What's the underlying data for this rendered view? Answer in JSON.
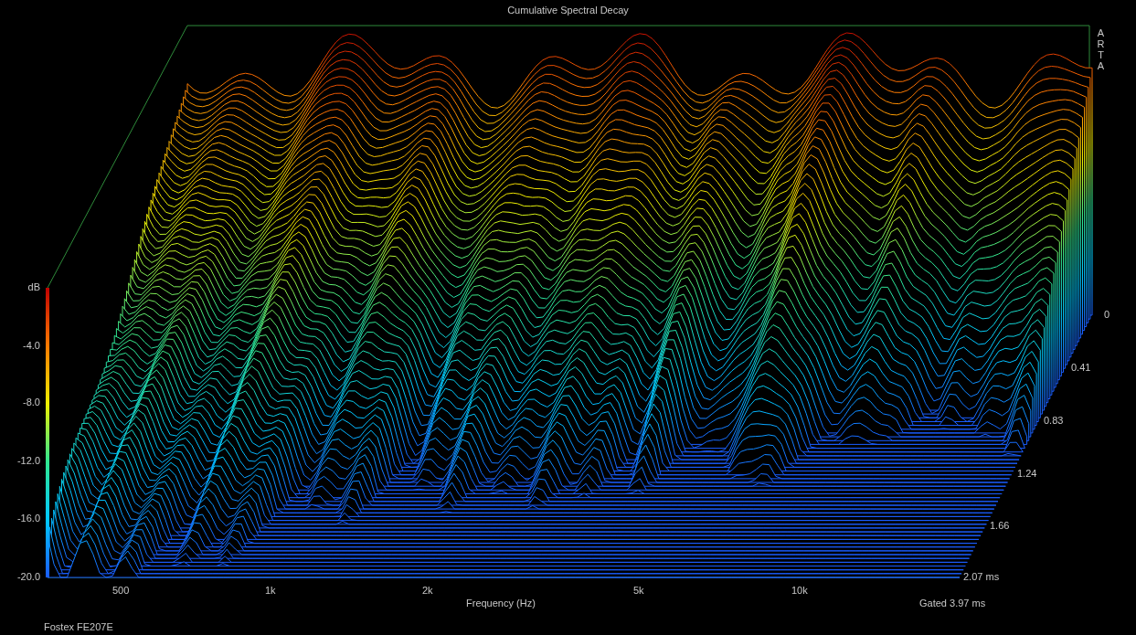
{
  "title": "Cumulative Spectral Decay",
  "brand": "ARTA",
  "y_axis": {
    "label": "dB",
    "ticks": [
      "-4.0",
      "-8.0",
      "-12.0",
      "-16.0",
      "-20.0"
    ]
  },
  "x_axis": {
    "label": "Frequency (Hz)",
    "ticks": [
      "500",
      "1k",
      "2k",
      "5k",
      "10k"
    ]
  },
  "time_axis": {
    "ticks": [
      "0",
      "0.41",
      "0.83",
      "1.24",
      "1.66",
      "2.07 ms"
    ]
  },
  "gate": "Gated 3.97 ms",
  "footer": "Fostex FE207E"
}
